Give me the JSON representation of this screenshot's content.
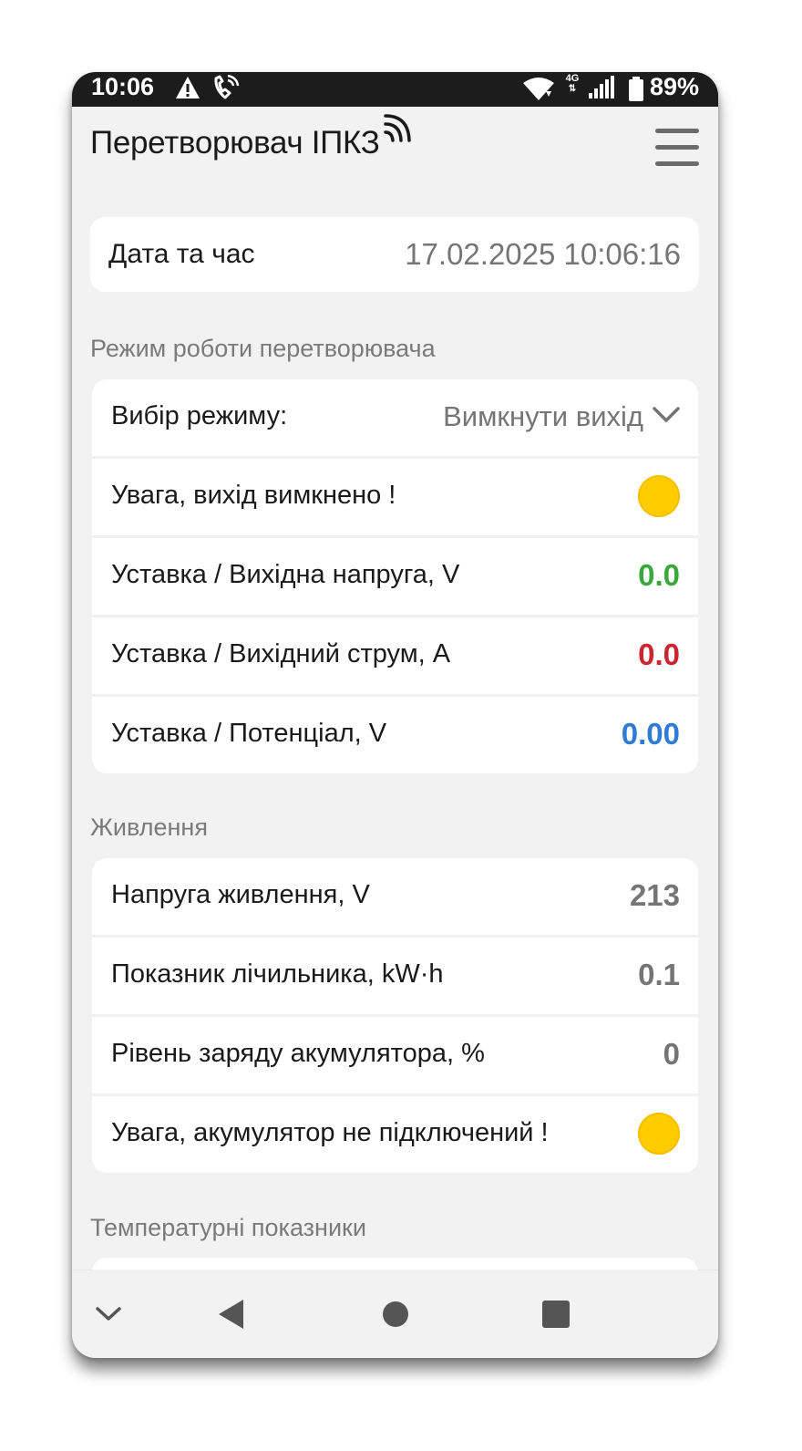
{
  "status_bar": {
    "time": "10:06",
    "warning_icon": "warning-icon",
    "call_icon": "wifi-call-icon",
    "wifi_icon": "wifi-icon",
    "network_type": "4G",
    "signal_icon": "signal-icon",
    "battery_icon": "battery-icon",
    "battery_percent": "89%"
  },
  "app_bar": {
    "title": "Перетворювач ІПКЗ",
    "nfc_icon": "nfc-icon",
    "menu_icon": "hamburger-menu-icon"
  },
  "datetime": {
    "label": "Дата та час",
    "value": "17.02.2025 10:06:16"
  },
  "mode_section": {
    "title": "Режим роботи перетворювача",
    "select_label": "Вибір режиму:",
    "select_value": "Вимкнути вихід",
    "warning_label": "Увага, вихід вимкнено !",
    "voltage_label": "Уставка / Вихідна напруга, V",
    "voltage_value": "0.0",
    "current_label": "Уставка / Вихідний струм, А",
    "current_value": "0.0",
    "potential_label": "Уставка / Потенціал, V",
    "potential_value": "0.00"
  },
  "power_section": {
    "title": "Живлення",
    "supply_label": "Напруга живлення, V",
    "supply_value": "213",
    "meter_label": "Показник лічильника, kW·h",
    "meter_value": "0.1",
    "battery_label": "Рівень заряду акумулятора, %",
    "battery_value": "0",
    "battery_warning_label": "Увага, акумулятор не підключений !"
  },
  "temperature_section": {
    "title": "Температурні показники"
  },
  "colors": {
    "green": "#3aa83a",
    "red": "#cc2430",
    "blue": "#2f7bd6",
    "indicator_yellow": "#ffcc00"
  },
  "nav_bar": {
    "hide_icon": "chevron-down-icon",
    "back_icon": "back-triangle-icon",
    "home_icon": "home-circle-icon",
    "recents_icon": "recents-square-icon"
  }
}
